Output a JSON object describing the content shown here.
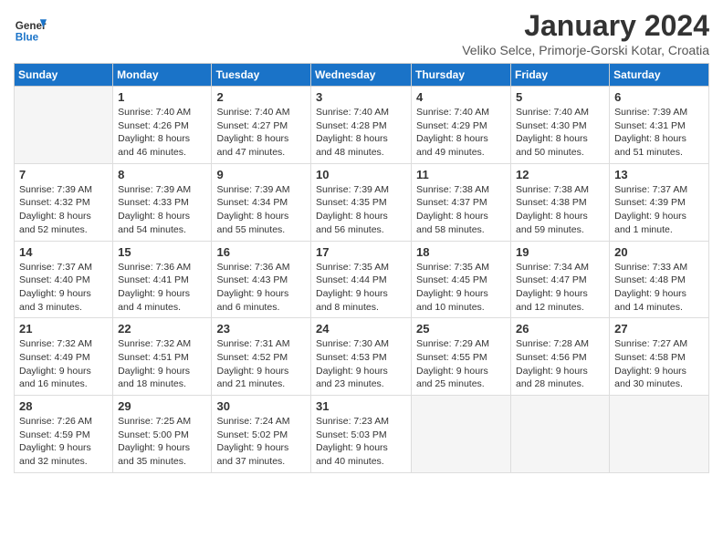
{
  "logo": {
    "line1": "General",
    "line2": "Blue"
  },
  "title": "January 2024",
  "location": "Veliko Selce, Primorje-Gorski Kotar, Croatia",
  "headers": [
    "Sunday",
    "Monday",
    "Tuesday",
    "Wednesday",
    "Thursday",
    "Friday",
    "Saturday"
  ],
  "weeks": [
    [
      {
        "day": "",
        "empty": true
      },
      {
        "day": "1",
        "sunrise": "7:40 AM",
        "sunset": "4:26 PM",
        "daylight": "8 hours and 46 minutes."
      },
      {
        "day": "2",
        "sunrise": "7:40 AM",
        "sunset": "4:27 PM",
        "daylight": "8 hours and 47 minutes."
      },
      {
        "day": "3",
        "sunrise": "7:40 AM",
        "sunset": "4:28 PM",
        "daylight": "8 hours and 48 minutes."
      },
      {
        "day": "4",
        "sunrise": "7:40 AM",
        "sunset": "4:29 PM",
        "daylight": "8 hours and 49 minutes."
      },
      {
        "day": "5",
        "sunrise": "7:40 AM",
        "sunset": "4:30 PM",
        "daylight": "8 hours and 50 minutes."
      },
      {
        "day": "6",
        "sunrise": "7:39 AM",
        "sunset": "4:31 PM",
        "daylight": "8 hours and 51 minutes."
      }
    ],
    [
      {
        "day": "7",
        "sunrise": "7:39 AM",
        "sunset": "4:32 PM",
        "daylight": "8 hours and 52 minutes."
      },
      {
        "day": "8",
        "sunrise": "7:39 AM",
        "sunset": "4:33 PM",
        "daylight": "8 hours and 54 minutes."
      },
      {
        "day": "9",
        "sunrise": "7:39 AM",
        "sunset": "4:34 PM",
        "daylight": "8 hours and 55 minutes."
      },
      {
        "day": "10",
        "sunrise": "7:39 AM",
        "sunset": "4:35 PM",
        "daylight": "8 hours and 56 minutes."
      },
      {
        "day": "11",
        "sunrise": "7:38 AM",
        "sunset": "4:37 PM",
        "daylight": "8 hours and 58 minutes."
      },
      {
        "day": "12",
        "sunrise": "7:38 AM",
        "sunset": "4:38 PM",
        "daylight": "8 hours and 59 minutes."
      },
      {
        "day": "13",
        "sunrise": "7:37 AM",
        "sunset": "4:39 PM",
        "daylight": "9 hours and 1 minute."
      }
    ],
    [
      {
        "day": "14",
        "sunrise": "7:37 AM",
        "sunset": "4:40 PM",
        "daylight": "9 hours and 3 minutes."
      },
      {
        "day": "15",
        "sunrise": "7:36 AM",
        "sunset": "4:41 PM",
        "daylight": "9 hours and 4 minutes."
      },
      {
        "day": "16",
        "sunrise": "7:36 AM",
        "sunset": "4:43 PM",
        "daylight": "9 hours and 6 minutes."
      },
      {
        "day": "17",
        "sunrise": "7:35 AM",
        "sunset": "4:44 PM",
        "daylight": "9 hours and 8 minutes."
      },
      {
        "day": "18",
        "sunrise": "7:35 AM",
        "sunset": "4:45 PM",
        "daylight": "9 hours and 10 minutes."
      },
      {
        "day": "19",
        "sunrise": "7:34 AM",
        "sunset": "4:47 PM",
        "daylight": "9 hours and 12 minutes."
      },
      {
        "day": "20",
        "sunrise": "7:33 AM",
        "sunset": "4:48 PM",
        "daylight": "9 hours and 14 minutes."
      }
    ],
    [
      {
        "day": "21",
        "sunrise": "7:32 AM",
        "sunset": "4:49 PM",
        "daylight": "9 hours and 16 minutes."
      },
      {
        "day": "22",
        "sunrise": "7:32 AM",
        "sunset": "4:51 PM",
        "daylight": "9 hours and 18 minutes."
      },
      {
        "day": "23",
        "sunrise": "7:31 AM",
        "sunset": "4:52 PM",
        "daylight": "9 hours and 21 minutes."
      },
      {
        "day": "24",
        "sunrise": "7:30 AM",
        "sunset": "4:53 PM",
        "daylight": "9 hours and 23 minutes."
      },
      {
        "day": "25",
        "sunrise": "7:29 AM",
        "sunset": "4:55 PM",
        "daylight": "9 hours and 25 minutes."
      },
      {
        "day": "26",
        "sunrise": "7:28 AM",
        "sunset": "4:56 PM",
        "daylight": "9 hours and 28 minutes."
      },
      {
        "day": "27",
        "sunrise": "7:27 AM",
        "sunset": "4:58 PM",
        "daylight": "9 hours and 30 minutes."
      }
    ],
    [
      {
        "day": "28",
        "sunrise": "7:26 AM",
        "sunset": "4:59 PM",
        "daylight": "9 hours and 32 minutes."
      },
      {
        "day": "29",
        "sunrise": "7:25 AM",
        "sunset": "5:00 PM",
        "daylight": "9 hours and 35 minutes."
      },
      {
        "day": "30",
        "sunrise": "7:24 AM",
        "sunset": "5:02 PM",
        "daylight": "9 hours and 37 minutes."
      },
      {
        "day": "31",
        "sunrise": "7:23 AM",
        "sunset": "5:03 PM",
        "daylight": "9 hours and 40 minutes."
      },
      {
        "day": "",
        "empty": true
      },
      {
        "day": "",
        "empty": true
      },
      {
        "day": "",
        "empty": true
      }
    ]
  ]
}
